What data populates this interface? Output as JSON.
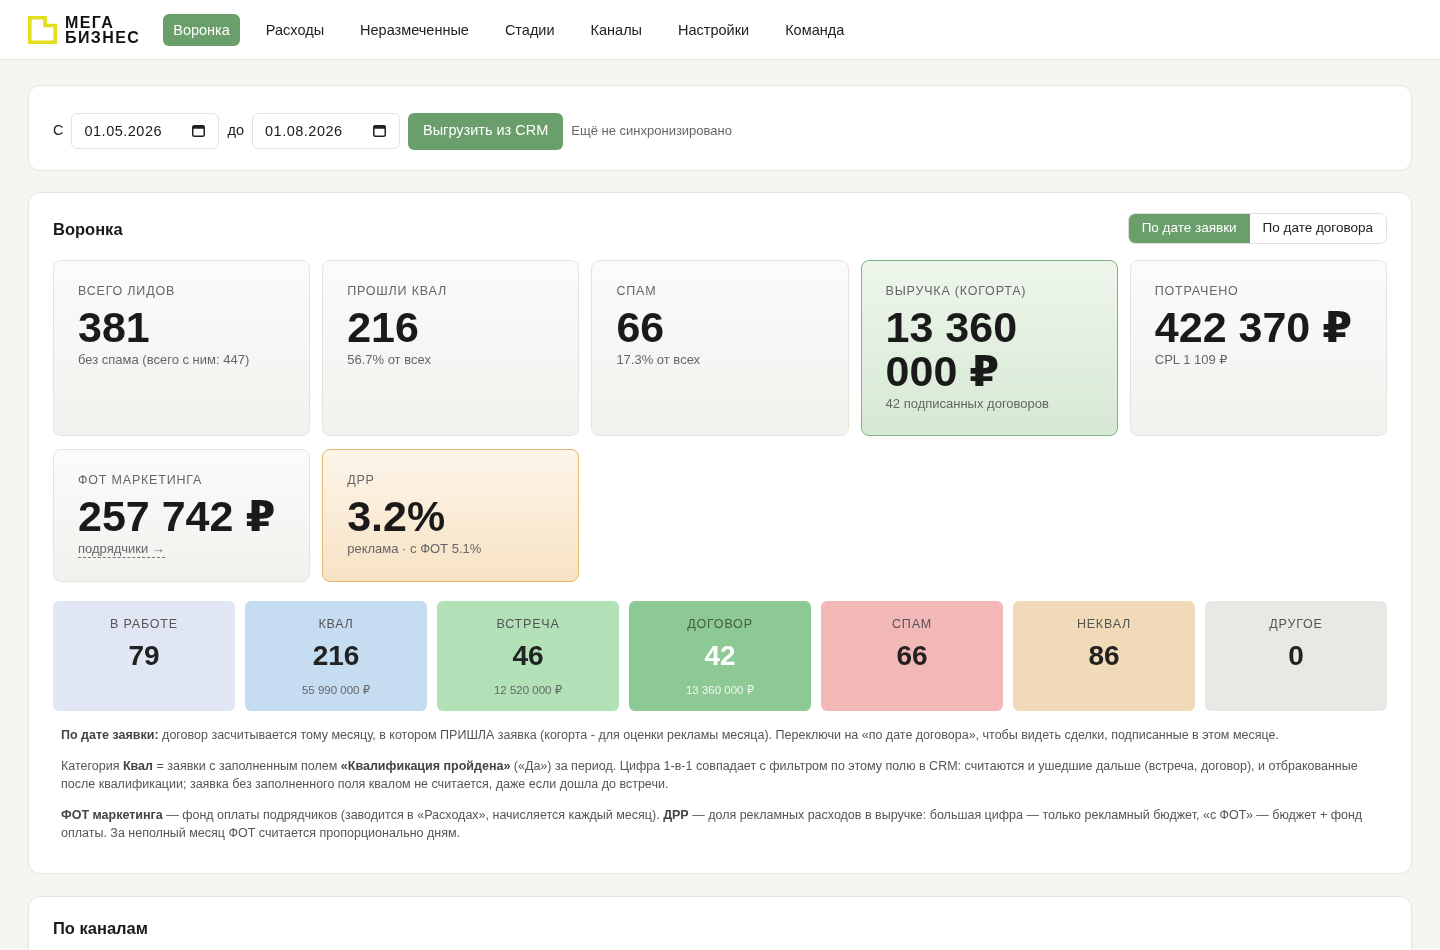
{
  "nav": {
    "logo_text": [
      "МЕГА",
      "БИЗНЕС"
    ],
    "items": [
      {
        "label": "Воронка",
        "selected": true
      },
      {
        "label": "Расходы",
        "selected": false
      },
      {
        "label": "Неразмеченные",
        "selected": false
      },
      {
        "label": "Стадии",
        "selected": false
      },
      {
        "label": "Каналы",
        "selected": false
      },
      {
        "label": "Настройки",
        "selected": false
      },
      {
        "label": "Команда",
        "selected": false
      }
    ]
  },
  "filters": {
    "from_label": "С",
    "from_value": "01.05.2026",
    "to_label": "до",
    "to_value": "01.08.2026",
    "export_button": "Выгрузить из CRM",
    "sync_status": "Ещё не синхронизировано"
  },
  "funnel": {
    "title": "Воронка",
    "mode_toggle": [
      {
        "label": "По дате заявки",
        "selected": true
      },
      {
        "label": "По дате договора",
        "selected": false
      }
    ],
    "metrics": [
      {
        "kind": "neutral",
        "label": "ВСЕГО ЛИДОВ",
        "value": "381",
        "note": "без спама (всего с ним: 447)"
      },
      {
        "kind": "neutral",
        "label": "ПРОШЛИ КВАЛ",
        "value": "216",
        "note": "56.7% от всех"
      },
      {
        "kind": "neutral",
        "label": "СПАМ",
        "value": "66",
        "note": "17.3% от всех"
      },
      {
        "kind": "accent",
        "label": "ВЫРУЧКА (КОГОРТА)",
        "value": "13 360 000 ₽",
        "note": "42 подписанных договоров"
      },
      {
        "kind": "neutral",
        "label": "ПОТРАЧЕНО",
        "value": "422 370 ₽",
        "note": "CPL 1 109 ₽"
      },
      {
        "kind": "neutral",
        "label": "ФОТ МАРКЕТИНГА",
        "value": "257 742 ₽",
        "link": "подрядчики →"
      },
      {
        "kind": "warm",
        "label": "ДРР",
        "value": "3.2%",
        "note": "реклама · с ФОТ 5.1%"
      }
    ],
    "stages": [
      {
        "label": "В РАБОТЕ",
        "count": "79",
        "color": "#e1e6f4"
      },
      {
        "label": "КВАЛ",
        "count": "216",
        "amount": "55 990 000 ₽",
        "color": "#c5dcf1"
      },
      {
        "label": "ВСТРЕЧА",
        "count": "46",
        "amount": "12 520 000 ₽",
        "color": "#b2e0b7"
      },
      {
        "label": "ДОГОВОР",
        "count": "42",
        "amount": "13 360 000 ₽",
        "color": "#8dc994"
      },
      {
        "label": "СПАМ",
        "count": "66",
        "color": "#f2b8b7"
      },
      {
        "label": "НЕКВАЛ",
        "count": "86",
        "color": "#f0dab7"
      },
      {
        "label": "ДРУГОЕ",
        "count": "0",
        "color": "#e8e8e4"
      }
    ],
    "notes": [
      "**По дате заявки:** договор засчитывается тому месяцу, в котором ПРИШЛА заявка (когорта - для оценки рекламы месяца). Переключи на «по дате договора», чтобы видеть сделки, подписанные в этом месяце.",
      "Категория **Квал** = заявки с заполненным полем **«Квалификация пройдена»** («Да») за период. Цифра 1-в-1 совпадает с фильтром по этому полю в CRM: считаются и ушедшие дальше (встреча, договор), и отбракованные после квалификации; заявка без заполненного поля квалом не считается, даже если дошла до встречи.",
      "**ФОТ маркетинга** — фонд оплаты подрядчиков (заводится в «Расходах», начисляется каждый месяц). **ДРР** — доля рекламных расходов в выручке: большая цифра — только рекламный бюджет, «с ФОТ» — бюджет + фонд оплаты. За неполный месяц ФОТ считается пропорционально дням."
    ]
  },
  "channels": {
    "title": "По каналам"
  }
}
